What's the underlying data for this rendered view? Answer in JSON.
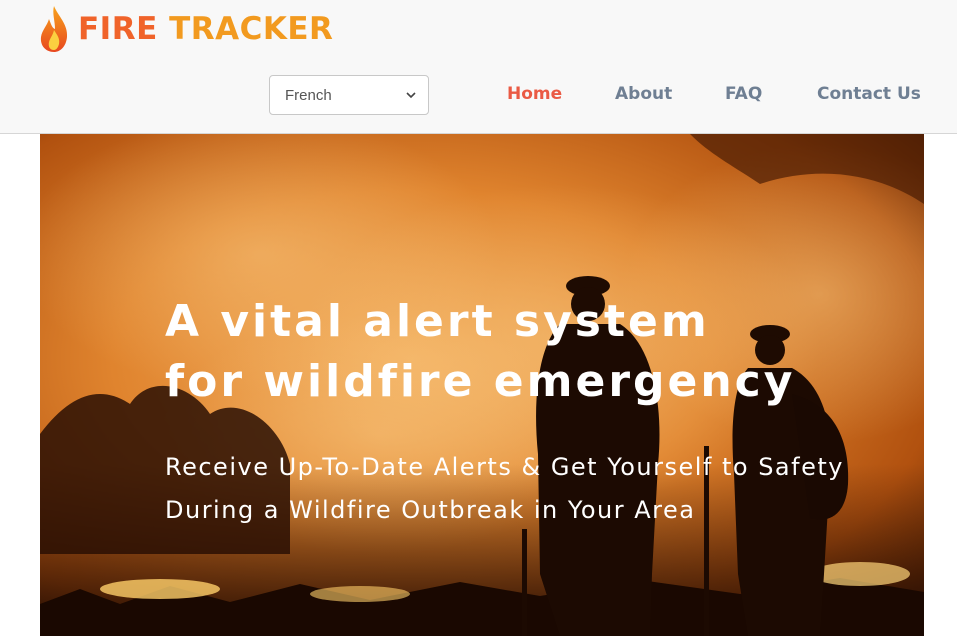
{
  "header": {
    "logo_text_part1": "FIRE ",
    "logo_text_part2": "TRACKER",
    "language_select": {
      "selected": "French"
    },
    "nav": [
      {
        "label": "Home",
        "active": true
      },
      {
        "label": "About",
        "active": false
      },
      {
        "label": "FAQ",
        "active": false
      },
      {
        "label": "Contact Us",
        "active": false
      }
    ]
  },
  "hero": {
    "title_line1": "A vital alert system",
    "title_line2": "for wildfire emergency",
    "subtitle_line1": "Receive Up-To-Date Alerts & Get Yourself to Safety",
    "subtitle_line2": "During a Wildfire Outbreak in Your Area",
    "image_subject": "firefighters in front of wildfire smoke"
  },
  "colors": {
    "logo_orange": "#f0632a",
    "logo_yellow": "#f29a1f",
    "nav_active": "#ea5a44",
    "nav_default": "#6f7f93",
    "header_bg": "#f8f8f8"
  }
}
